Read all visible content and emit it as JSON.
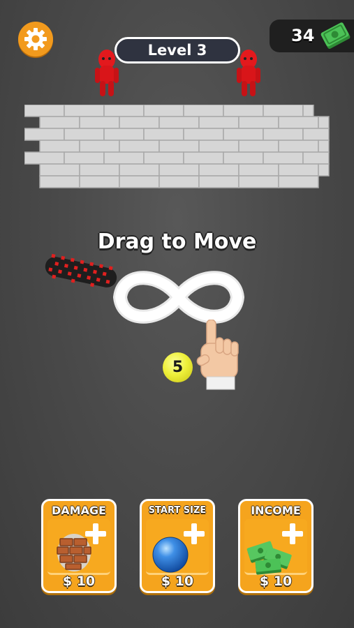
{
  "header": {
    "level_label": "Level 3",
    "money_amount": "34"
  },
  "hint": {
    "text": "Drag to Move"
  },
  "ball": {
    "value": "5"
  },
  "upgrades": [
    {
      "title": "DAMAGE",
      "price": "$ 10",
      "icon": "brick-icon"
    },
    {
      "title": "START SIZE",
      "price": "$ 10",
      "icon": "ball-icon"
    },
    {
      "title": "INCOME",
      "price": "$ 10",
      "icon": "cash-stack-icon"
    }
  ],
  "colors": {
    "accent_orange": "#f5a41d",
    "enemy_red": "#e0181c",
    "money_green": "#3fb54a",
    "ball_yellow": "#eef03a",
    "background": "#4a4a4a"
  },
  "icons": {
    "settings": "gear-icon",
    "money": "cash-icon",
    "enemy": "red-figure-icon",
    "roller": "spiked-roller-icon",
    "path": "infinity-path",
    "hand": "pointing-hand-icon"
  }
}
